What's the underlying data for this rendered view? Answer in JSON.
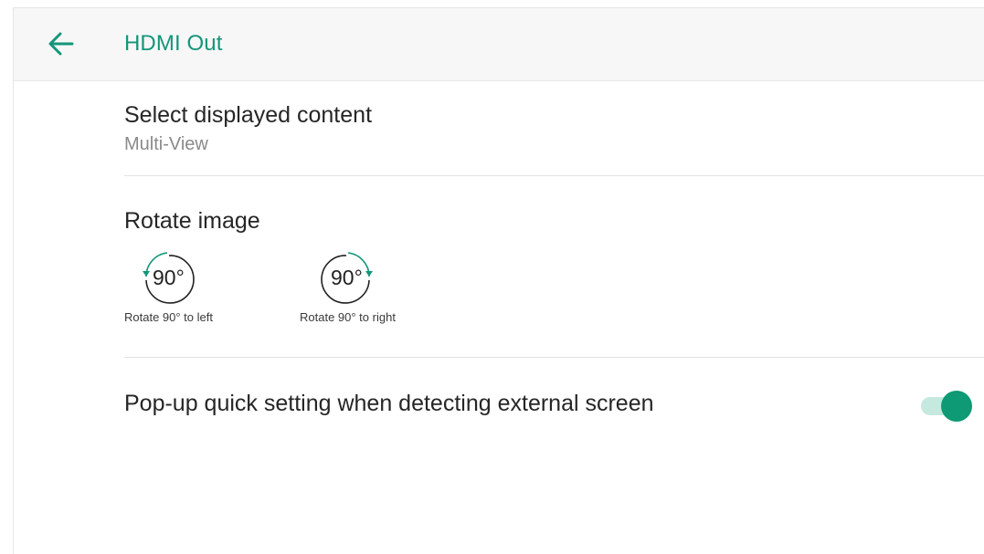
{
  "header": {
    "title": "HDMI Out",
    "back_icon": "arrow-left-icon"
  },
  "settings": {
    "display_content": {
      "title": "Select displayed content",
      "value": "Multi-View"
    },
    "rotate": {
      "title": "Rotate image",
      "options": [
        {
          "value_text": "90°",
          "caption": "Rotate 90° to left",
          "icon": "rotate-left-icon"
        },
        {
          "value_text": "90°",
          "caption": "Rotate 90° to right",
          "icon": "rotate-right-icon"
        }
      ]
    },
    "popup": {
      "title": "Pop-up quick setting when detecting external screen",
      "enabled": true
    }
  },
  "colors": {
    "accent": "#13967a",
    "toggle_on": "#0e9a74",
    "toggle_track": "#c5e9df"
  }
}
